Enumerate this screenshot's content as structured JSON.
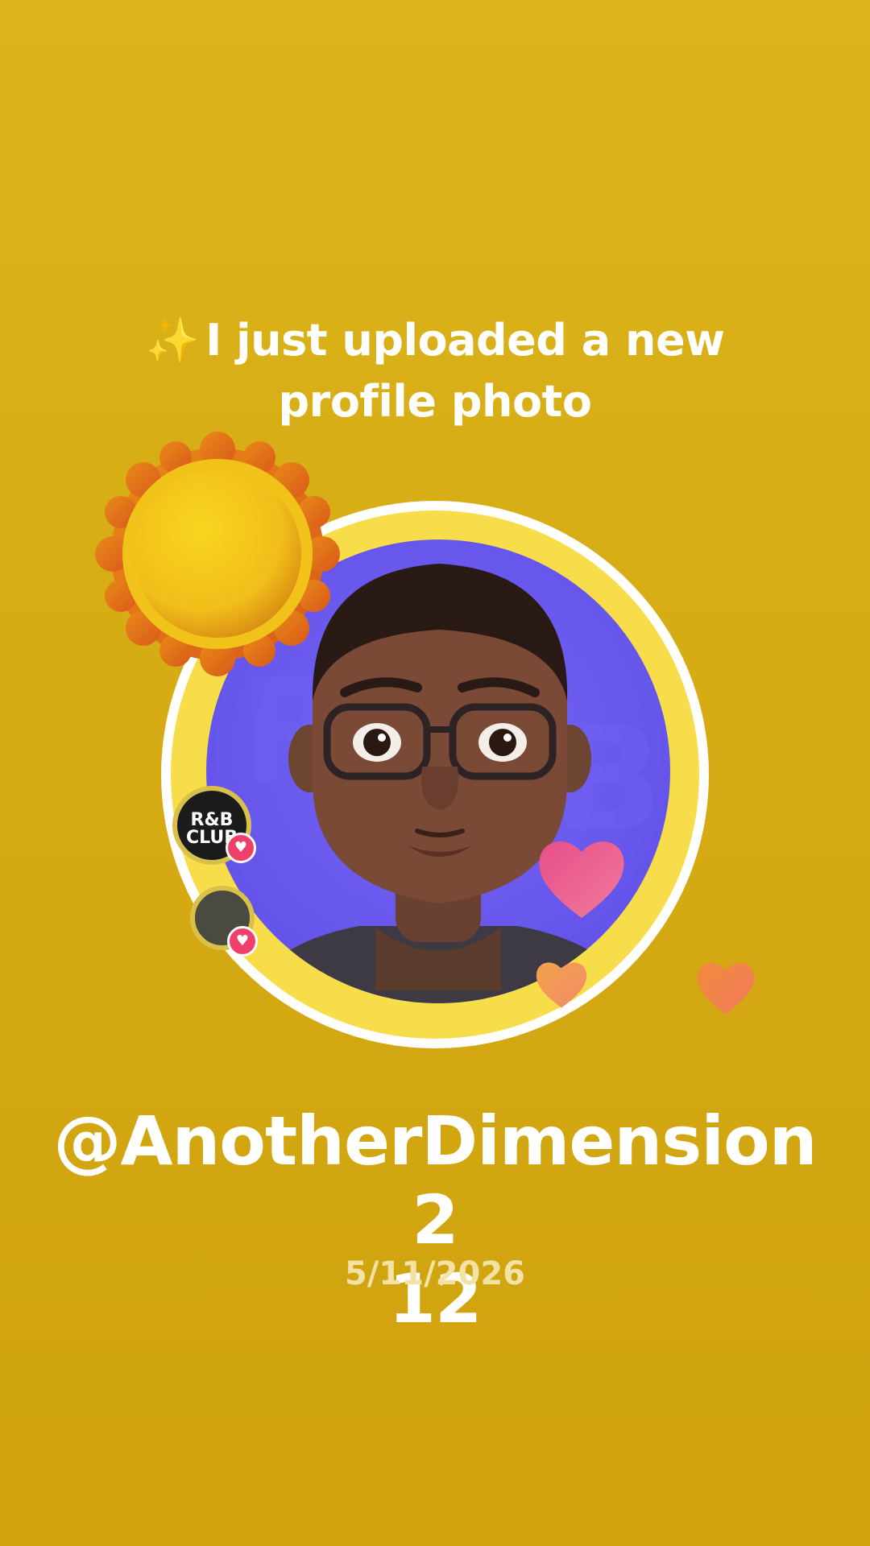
{
  "announcement": {
    "sparkle_icon": "✨",
    "line1": "I just uploaded a new",
    "line2": "profile photo"
  },
  "profile": {
    "username_line1": "@AnotherDimension2",
    "username_line2": "12",
    "date": "5/11/2026"
  },
  "side_chips": [
    {
      "label": "R&B CLUB",
      "icon": "heart-icon"
    },
    {
      "label": "",
      "icon": "heart-icon"
    }
  ],
  "icons": {
    "sun": "sun-icon",
    "hearts": [
      "heart-icon",
      "heart-icon",
      "heart-icon"
    ]
  },
  "colors": {
    "background": "#d6ab14",
    "ring": "#f8dd4a",
    "photo_bg": "#6454ea",
    "text": "#ffffff",
    "date_text": "#f2e2a6"
  }
}
